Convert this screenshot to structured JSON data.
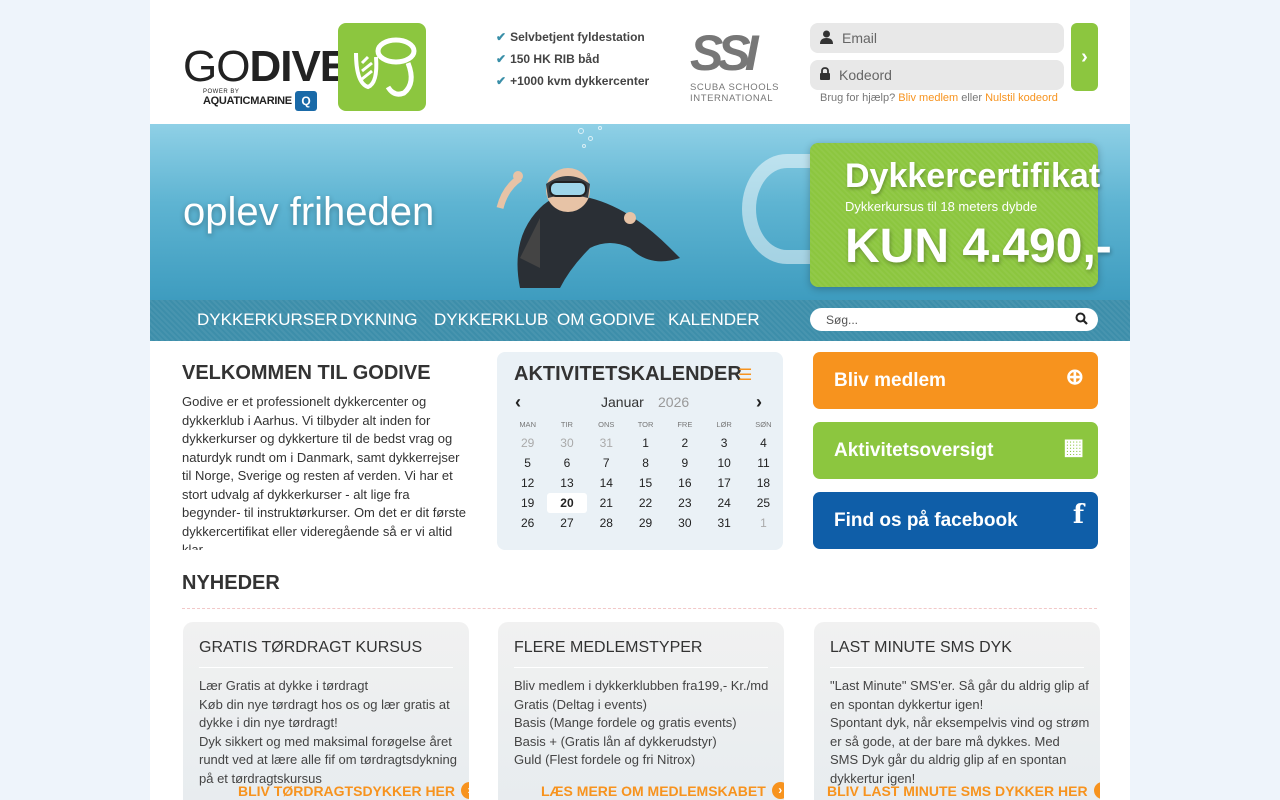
{
  "brand": {
    "logo_go": "GO",
    "logo_dive": "DIVE",
    "logo_power": "POWER BY",
    "logo_aquatic": "AQUATICMARINE",
    "logo_q": "Q"
  },
  "features": [
    "Selvbetjent fyldestation",
    "150 HK RIB båd",
    "+1000 kvm dykkercenter"
  ],
  "ssi": {
    "mark": "SSI",
    "line1": "SCUBA SCHOOLS",
    "line2": "INTERNATIONAL"
  },
  "login": {
    "email_placeholder": "Email",
    "password_placeholder": "Kodeord",
    "help_text": "Brug for hjælp?",
    "join_link": "Bliv medlem",
    "or": "eller",
    "reset_link": "Nulstil kodeord",
    "submit_glyph": "›"
  },
  "hero": {
    "tagline": "oplev friheden",
    "promo_title": "Dykkercertifikat",
    "promo_sub": "Dykkerkursus til 18 meters dybde",
    "promo_price": "KUN 4.490,-"
  },
  "nav": {
    "items": [
      "DYKKERKURSER",
      "DYKNING",
      "DYKKERKLUB",
      "OM GODIVE",
      "KALENDER"
    ],
    "search_placeholder": "Søg..."
  },
  "welcome": {
    "title": "VELKOMMEN TIL GODIVE",
    "text": "Godive er et professionelt dykkercenter og dykkerklub i Aarhus. Vi tilbyder alt inden for dykkerkurser og dykkerture til de bedst vrag og naturdyk rundt om i Danmark, samt dykkerrejser til Norge, Sverige og resten af verden. Vi har et stort udvalg af dykkerkurser - alt lige fra begynder- til instruktørkurser. Om det er dit første dykkercertifikat eller videregående så er vi altid klar"
  },
  "calendar": {
    "title": "AKTIVITETSKALENDER",
    "month": "Januar",
    "year": "2026",
    "dows": [
      "MAN",
      "TIR",
      "ONS",
      "TOR",
      "FRE",
      "LØR",
      "SØN"
    ],
    "weeks": [
      [
        "29",
        "30",
        "31",
        "1",
        "2",
        "3",
        "4"
      ],
      [
        "5",
        "6",
        "7",
        "8",
        "9",
        "10",
        "11"
      ],
      [
        "12",
        "13",
        "14",
        "15",
        "16",
        "17",
        "18"
      ],
      [
        "19",
        "20",
        "21",
        "22",
        "23",
        "24",
        "25"
      ],
      [
        "26",
        "27",
        "28",
        "29",
        "30",
        "31",
        "1"
      ]
    ]
  },
  "side_buttons": [
    {
      "label": "Bliv medlem",
      "icon": "plus-circle-icon",
      "glyph": "⊕"
    },
    {
      "label": "Aktivitetsoversigt",
      "icon": "calendar-icon",
      "glyph": "▦"
    },
    {
      "label": "Find os på facebook",
      "icon": "facebook-icon",
      "glyph": "f"
    }
  ],
  "colors": {
    "orange": "#f7931e",
    "green": "#8cc63f",
    "blue": "#0f5ea8",
    "nav": "#3d8eaa"
  },
  "news": {
    "title": "NYHEDER",
    "cards": [
      {
        "title": "GRATIS TØRDRAGT KURSUS",
        "lines": [
          "Lær Gratis at dykke i tørdragt",
          "Køb din nye tørdragt hos os og lær gratis at dykke i din nye tørdragt!",
          "Dyk sikkert og med maksimal forøgelse året rundt ved at lære alle fif om tørdragtsdykning på et tørdragtskursus"
        ],
        "link": "BLIV TØRDRAGTSDYKKER HER"
      },
      {
        "title": "FLERE MEDLEMSTYPER",
        "lines": [
          "Bliv medlem i dykkerklubben fra199,- Kr./md",
          "Gratis (Deltag i events)",
          "Basis (Mange fordele og gratis events)",
          "Basis + (Gratis lån af dykkerudstyr)",
          "Guld (Flest fordele og fri Nitrox)"
        ],
        "link": "LÆS MERE OM MEDLEMSKABET"
      },
      {
        "title": "LAST MINUTE SMS DYK",
        "lines": [
          "\"Last Minute\" SMS'er. Så går du aldrig glip af en spontan dykkertur igen!",
          "Spontant dyk, når eksempelvis vind og strøm er så gode, at der bare må dykkes. Med SMS Dyk går du aldrig glip af en spontan dykkertur igen!"
        ],
        "link": "BLIV LAST MINUTE SMS DYKKER HER"
      }
    ]
  }
}
